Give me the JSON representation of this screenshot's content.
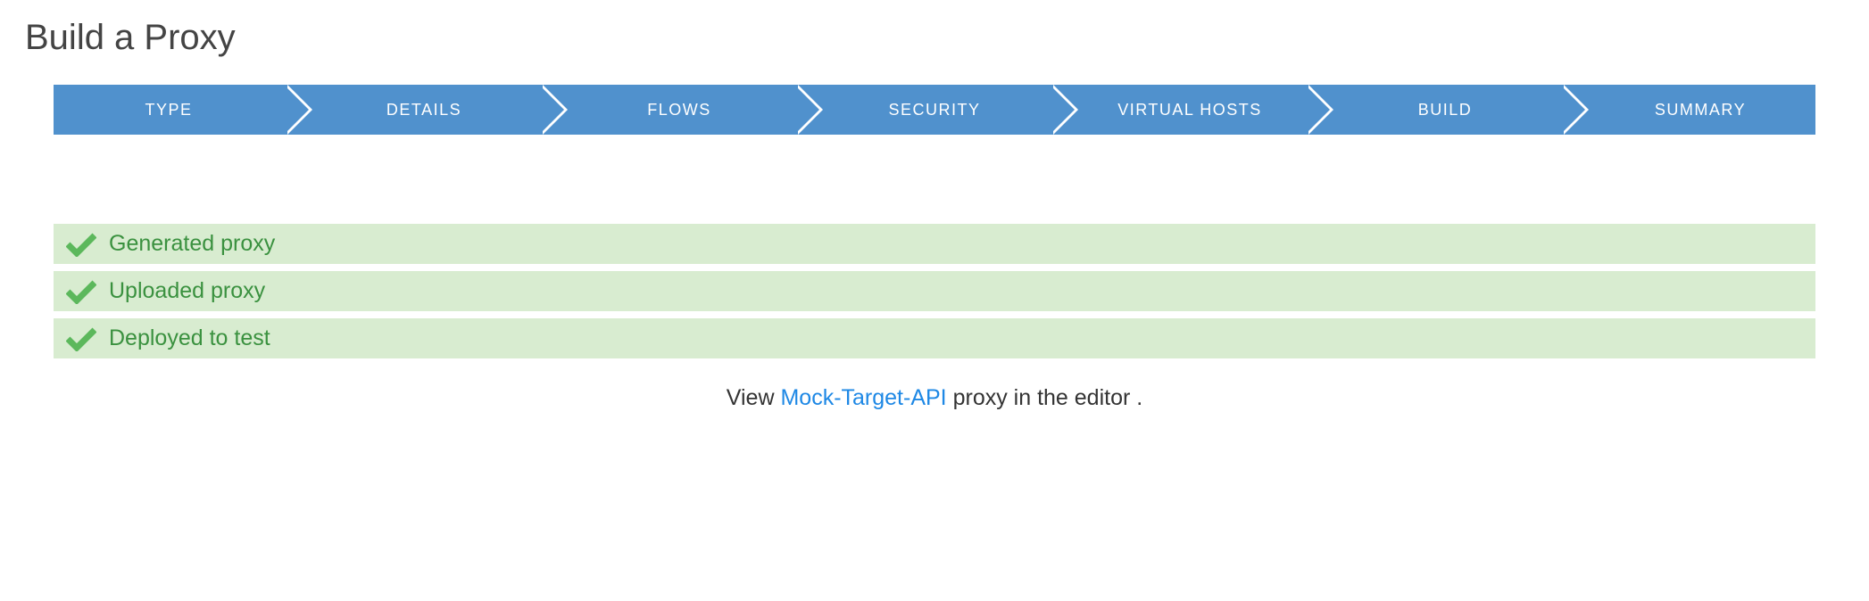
{
  "title": "Build a Proxy",
  "steps": [
    {
      "label": "TYPE"
    },
    {
      "label": "DETAILS"
    },
    {
      "label": "FLOWS"
    },
    {
      "label": "SECURITY"
    },
    {
      "label": "VIRTUAL HOSTS"
    },
    {
      "label": "BUILD"
    },
    {
      "label": "SUMMARY"
    }
  ],
  "statuses": [
    {
      "label": "Generated proxy"
    },
    {
      "label": "Uploaded proxy"
    },
    {
      "label": "Deployed to test"
    }
  ],
  "footer": {
    "prefix": "View ",
    "link": "Mock-Target-API",
    "suffix": " proxy in the editor ."
  }
}
